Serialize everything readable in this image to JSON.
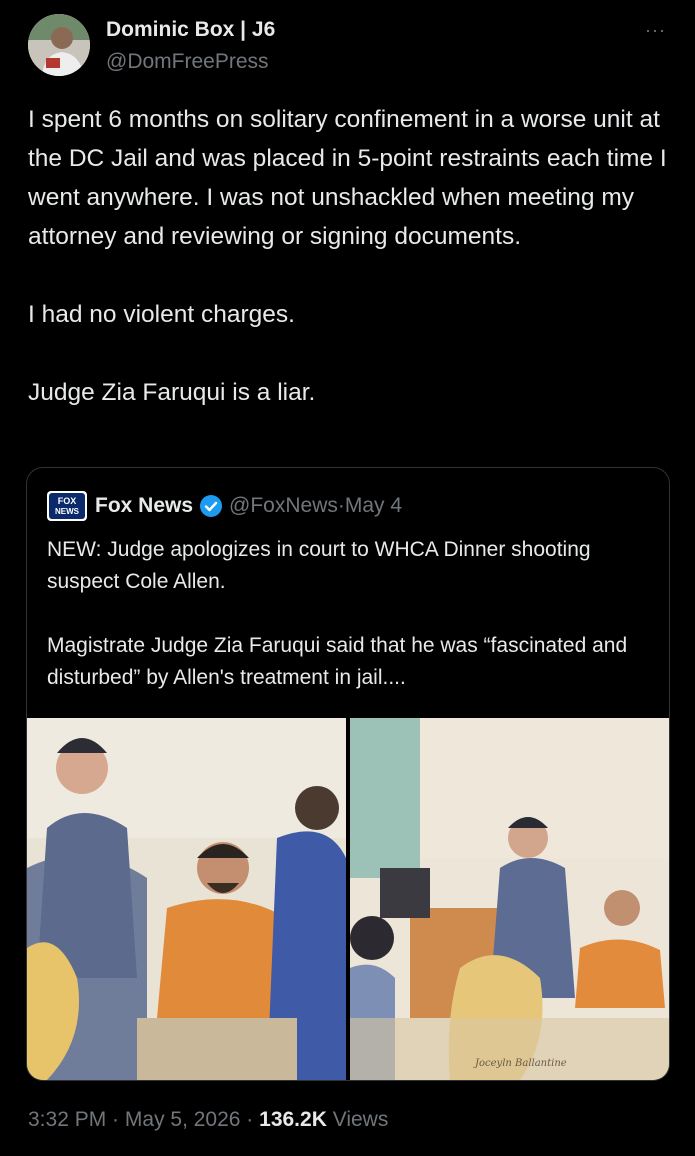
{
  "post": {
    "author_name": "Dominic Box | J6",
    "author_handle": "@DomFreePress",
    "more_label": "···",
    "paragraphs": [
      "I spent 6 months on solitary confinement in a worse unit at the DC Jail and was placed in 5-point restraints each time I went anywhere. I was not unshackled when meeting my attorney and reviewing or signing documents.",
      "I had no violent charges.",
      "Judge Zia Faruqui is a liar."
    ]
  },
  "quote": {
    "author_name": "Fox News",
    "author_handle": "@FoxNews",
    "separator": " · ",
    "date": "May 4",
    "logo_text": "FOX NEWS",
    "paragraphs": [
      "NEW: Judge apologizes in court to WHCA Dinner shooting suspect Cole Allen.",
      "Magistrate Judge Zia Faruqui said that he was “fascinated and disturbed” by Allen's treatment in jail...."
    ],
    "signature": "Joceyln Ballantine"
  },
  "footer": {
    "time": "3:32 PM",
    "sep": " · ",
    "date": "May 5, 2026",
    "views_count": "136.2K",
    "views_label": "Views"
  },
  "colors": {
    "background": "#000000",
    "text": "#e7e9ea",
    "muted": "#71767b",
    "verified": "#1d9bf0",
    "border": "#2f3336"
  }
}
